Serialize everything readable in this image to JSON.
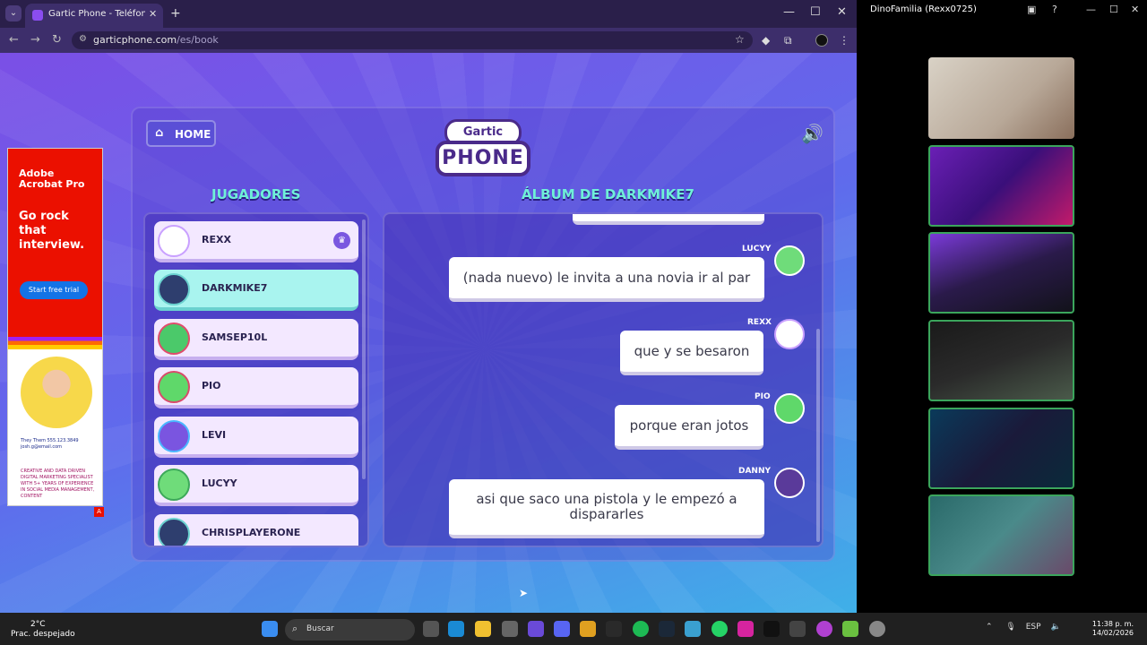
{
  "browser": {
    "tab_title": "Gartic Phone - Teléfono Descon",
    "url_host": "garticphone.com",
    "url_path": "/es/book"
  },
  "game": {
    "home_label": "HOME",
    "logo_top": "Gartic",
    "logo_bottom": "PHONE",
    "players_heading": "JUGADORES",
    "album_heading": "ÁLBUM DE DARKMIKE7",
    "players": [
      {
        "name": "REXX",
        "host": true,
        "active": false
      },
      {
        "name": "DARKMIKE7",
        "host": false,
        "active": true
      },
      {
        "name": "SAMSEP10L",
        "host": false,
        "active": false
      },
      {
        "name": "PIO",
        "host": false,
        "active": false
      },
      {
        "name": "LEVI",
        "host": false,
        "active": false
      },
      {
        "name": "LUCYY",
        "host": false,
        "active": false
      },
      {
        "name": "CHRISPLAYERONE",
        "host": false,
        "active": false
      }
    ],
    "messages": [
      {
        "author": "LUCYY",
        "text": "(nada nuevo) le invita a una novia ir al par"
      },
      {
        "author": "REXX",
        "text": "que y se besaron"
      },
      {
        "author": "PIO",
        "text": "porque eran jotos"
      },
      {
        "author": "DANNY",
        "text": "asi que saco una pistola y le empezó a dispararles"
      }
    ]
  },
  "ad": {
    "brand": "Adobe Acrobat Pro",
    "headline": "Go rock that interview.",
    "cta": "Start free trial",
    "contact": "They Them 555.123.3849 josh.g@email.com",
    "blurb": "CREATIVE AND DATA DRIVEN DIGITAL MARKETING SPECIALIST WITH 5+ YEARS OF EXPERIENCE IN SOCIAL MEDIA MANAGEMENT, CONTENT"
  },
  "discord": {
    "title": "DinoFamilia (Rexx0725)"
  },
  "taskbar": {
    "temp": "2°C",
    "weather": "Prac. despejado",
    "search": "Buscar",
    "lang": "ESP",
    "time": "11:38 p. m.",
    "date": "14/02/2026"
  },
  "colors": {
    "accent": "#6ff0d8",
    "ad_red": "#eb1000",
    "cam_border": "#3ba55c"
  }
}
